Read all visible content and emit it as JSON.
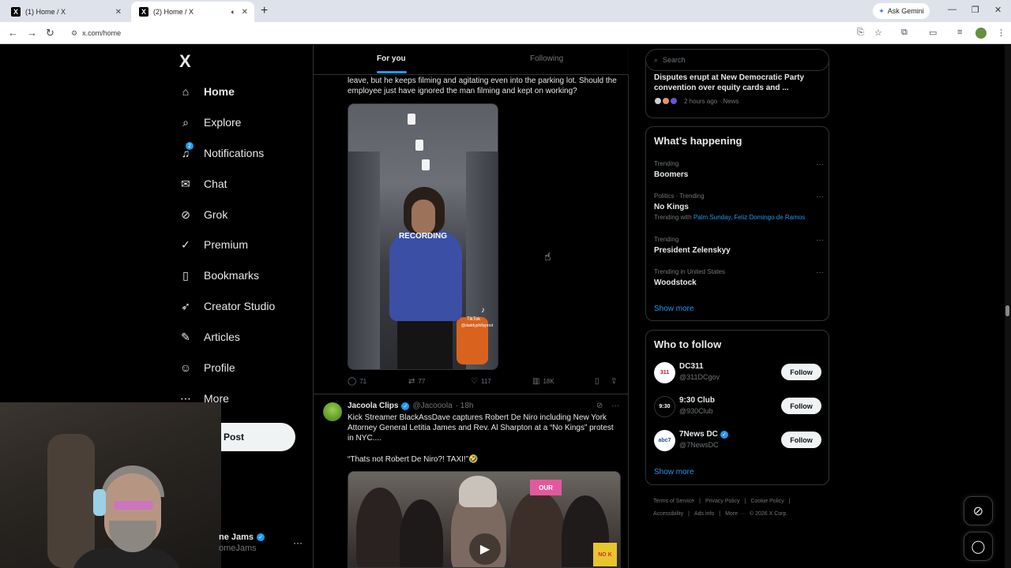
{
  "browser": {
    "tabs": [
      {
        "title": "(1) Home / X",
        "active": false
      },
      {
        "title": "(2) Home / X",
        "active": true
      }
    ],
    "ask_gemini": "Ask Gemini",
    "url": "x.com/home"
  },
  "nav": {
    "logo": "X",
    "items": [
      {
        "label": "Home",
        "icon": "home-icon",
        "glyph": "⌂"
      },
      {
        "label": "Explore",
        "icon": "search-icon",
        "glyph": "⌕"
      },
      {
        "label": "Notifications",
        "icon": "bell-icon",
        "glyph": "♫",
        "badge": "2"
      },
      {
        "label": "Chat",
        "icon": "mail-icon",
        "glyph": "✉"
      },
      {
        "label": "Grok",
        "icon": "grok-icon",
        "glyph": "⊘"
      },
      {
        "label": "Premium",
        "icon": "premium-icon",
        "glyph": "✓"
      },
      {
        "label": "Bookmarks",
        "icon": "bookmark-icon",
        "glyph": "▯"
      },
      {
        "label": "Creator Studio",
        "icon": "rocket-icon",
        "glyph": "➶"
      },
      {
        "label": "Articles",
        "icon": "articles-icon",
        "glyph": "✎"
      },
      {
        "label": "Profile",
        "icon": "profile-icon",
        "glyph": "☺"
      },
      {
        "label": "More",
        "icon": "more-icon",
        "glyph": "⋯"
      }
    ],
    "post": "Post",
    "account": {
      "name": "ne Jams",
      "handle": "omeJams"
    }
  },
  "timeline": {
    "tabs": [
      "For you",
      "Following"
    ],
    "tweet1": {
      "text": "leave, but he keeps filming and agitating even into the parking lot. Should the employee just have ignored the man filming and kept on working?",
      "overlay": "RECORDING",
      "tiktok": "TikTok",
      "tiktok_handle": "@daddyphillyprod",
      "replies": "71",
      "reposts": "77",
      "likes": "117",
      "views": "18K"
    },
    "tweet2": {
      "name": "Jacoola Clips",
      "handle": "@Jacooola",
      "time": "· 18h",
      "text": "Kick Streamer BlackAssDave captures Robert De Niro including New York Attorney General Letitia James and Rev.  Al Sharpton at a “No Kings” protest in NYC....",
      "quote": "“Thats not Robert De Niro?! TAXI!”🤣"
    }
  },
  "sidebar": {
    "search_placeholder": "Search",
    "news": {
      "title": "Disputes erupt at New Democratic Party convention over equity cards and ...",
      "meta": "2 hours ago · News"
    },
    "happening": {
      "title": "What’s happening",
      "trends": [
        {
          "context": "Trending",
          "topic": "Boomers"
        },
        {
          "context": "Politics · Trending",
          "topic": "No Kings",
          "with_label": "Trending with",
          "with_topics": "Palm Sunday, Feliz Domingo de Ramos"
        },
        {
          "context": "Trending",
          "topic": "President Zelenskyy"
        },
        {
          "context": "Trending in United States",
          "topic": "Woodstock"
        }
      ],
      "show_more": "Show more"
    },
    "who_to_follow": {
      "title": "Who to follow",
      "accounts": [
        {
          "name": "DC311",
          "handle": "@311DCgov",
          "avatar_text": "311",
          "verified": false
        },
        {
          "name": "9:30 Club",
          "handle": "@930Club",
          "avatar_text": "9:30",
          "verified": false
        },
        {
          "name": "7News DC",
          "handle": "@7NewsDC",
          "avatar_text": "abc7",
          "verified": true
        }
      ],
      "follow_label": "Follow",
      "show_more": "Show more"
    },
    "footer": [
      "Terms of Service",
      "|",
      "Privacy Policy",
      "|",
      "Cookie Policy",
      "|",
      "Accessibility",
      "|",
      "Ads info",
      "|",
      "More ···",
      "© 2026 X Corp."
    ]
  },
  "colors": {
    "accent": "#1d9bf0",
    "background": "#000000",
    "border": "#2f3336",
    "muted": "#71767b"
  }
}
